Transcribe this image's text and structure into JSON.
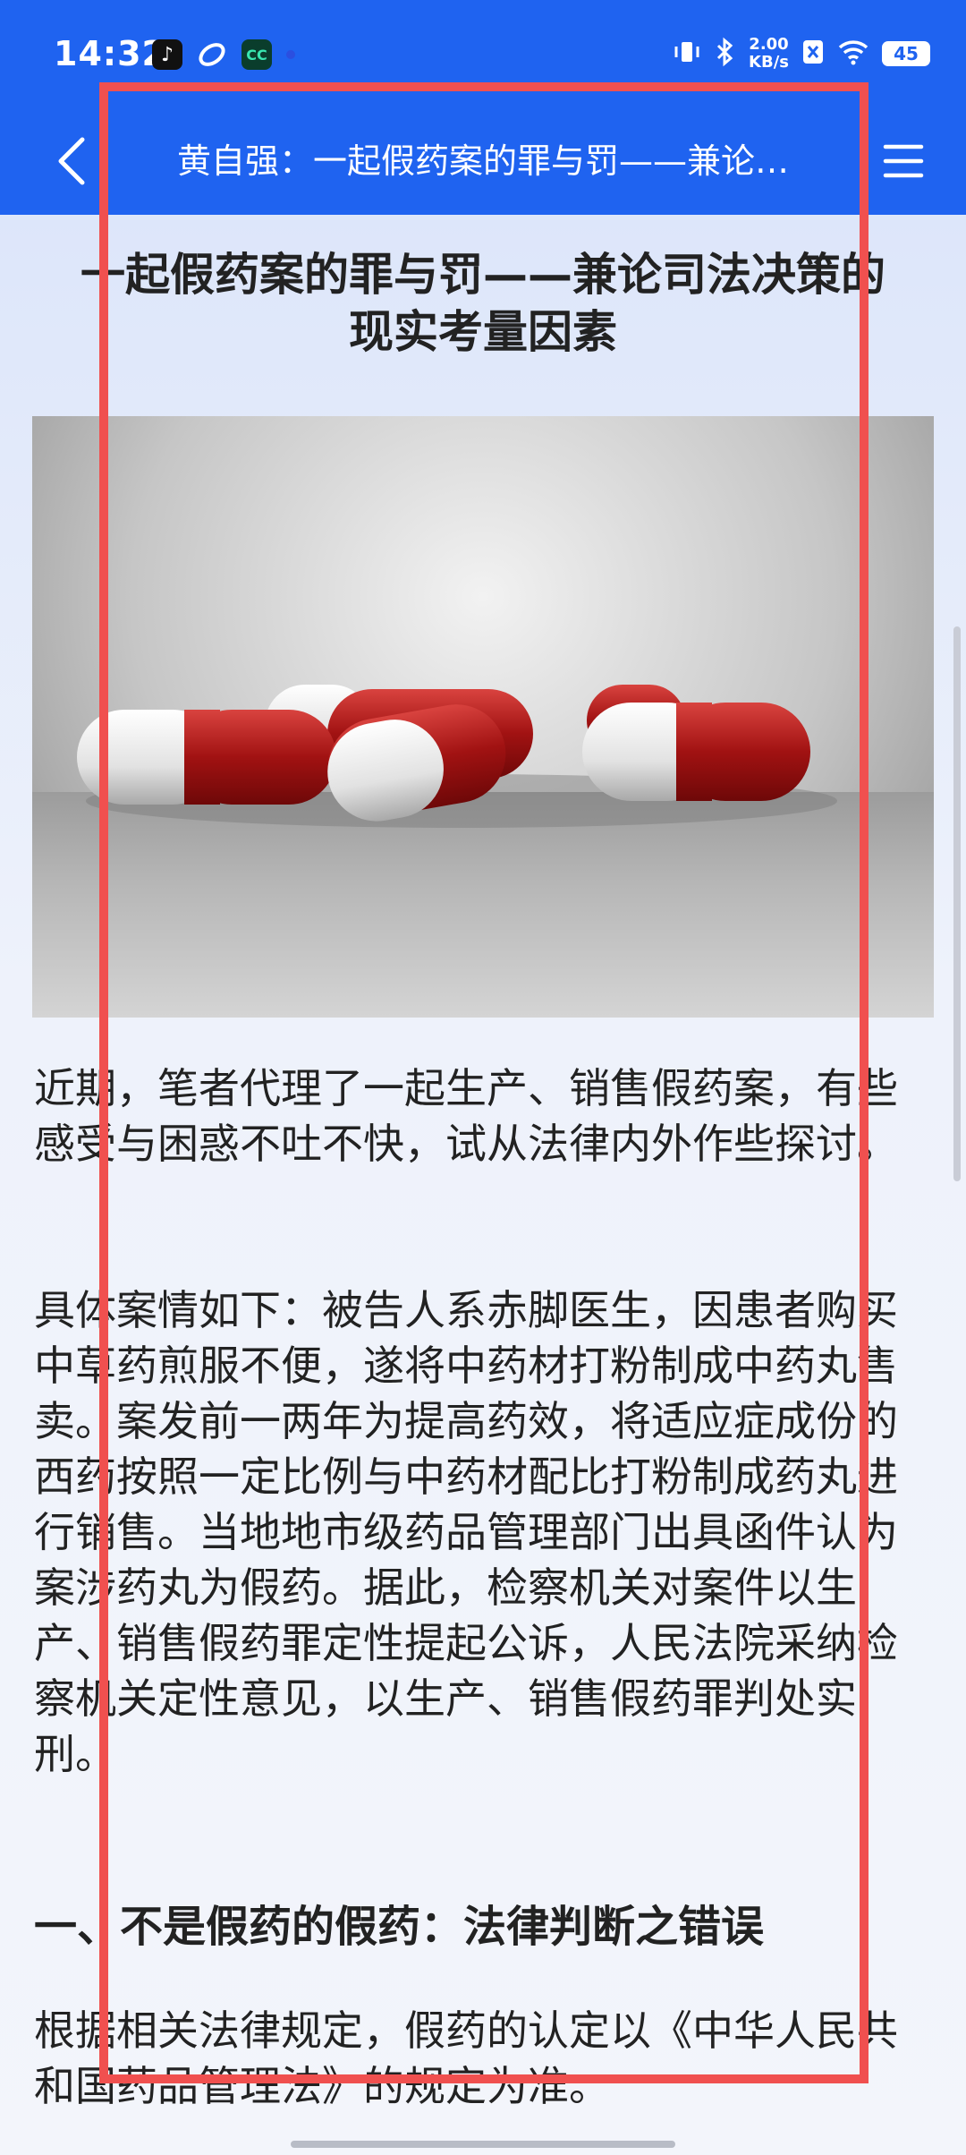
{
  "status_bar": {
    "time": "14:32",
    "network_speed_value": "2.00",
    "network_speed_unit": "KB/s",
    "battery": "45",
    "left_icons": [
      "tiktok-icon",
      "app-icon",
      "cc-app-icon"
    ],
    "right_icons": [
      "vibrate-icon",
      "bluetooth-icon",
      "network-speed",
      "sim-off-icon",
      "wifi-icon",
      "battery-icon"
    ]
  },
  "nav": {
    "title": "黄自强：一起假药案的罪与罚——兼论…",
    "back_icon": "chevron-left-icon",
    "menu_icon": "hamburger-menu-icon"
  },
  "article": {
    "title_line1": "一起假药案的罪与罚——兼论司法决策的",
    "title_line2": "现实考量因素",
    "image_subject": "red-and-white-capsules",
    "paragraphs": [
      "近期，笔者代理了一起生产、销售假药案，有些感受与困惑不吐不快，试从法律内外作些探讨。",
      "具体案情如下：被告人系赤脚医生，因患者购买中草药煎服不便，遂将中药材打粉制成中药丸售卖。案发前一两年为提高药效，将适应症成份的西药按照一定比例与中药材配比打粉制成药丸进行销售。当地地市级药品管理部门出具函件认为案涉药丸为假药。据此，检察机关对案件以生产、销售假药罪定性提起公诉，人民法院采纳检察机关定性意见，以生产、销售假药罪判处实刑。"
    ],
    "section_heading": "一、不是假药的假药：法律判断之错误",
    "last_paragraph": "根据相关法律规定，假药的认定以《中华人民共和国药品管理法》的规定为准。"
  },
  "colors": {
    "header_bg": "#1f63f0",
    "highlight_border": "#f0504f",
    "text": "#222222"
  }
}
